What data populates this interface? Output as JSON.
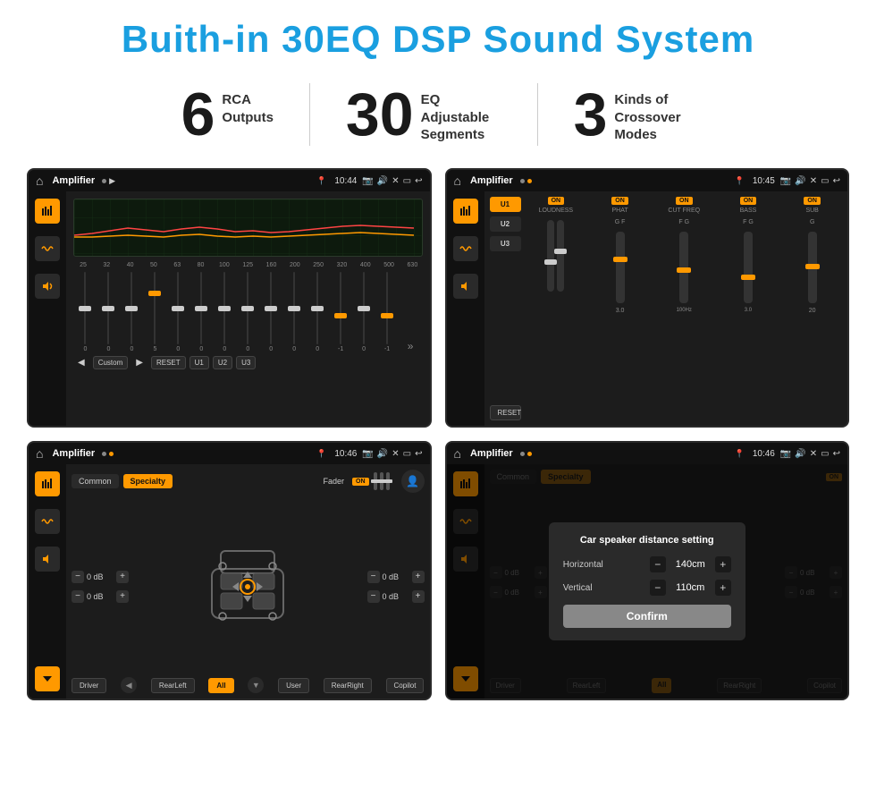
{
  "page": {
    "title": "Buith-in 30EQ DSP Sound System",
    "title_color": "#1a9fe0"
  },
  "stats": [
    {
      "id": "rca",
      "number": "6",
      "label": "RCA\nOutputs"
    },
    {
      "id": "eq",
      "number": "30",
      "label": "EQ Adjustable\nSegments"
    },
    {
      "id": "crossover",
      "number": "3",
      "label": "Kinds of\nCrossover Modes"
    }
  ],
  "screens": {
    "eq_screen": {
      "title": "Amplifier",
      "time": "10:44",
      "eq_values": [
        "25",
        "32",
        "40",
        "50",
        "63",
        "80",
        "100",
        "125",
        "160",
        "200",
        "250",
        "320",
        "400",
        "500",
        "630"
      ],
      "bottom_values": [
        "0",
        "0",
        "0",
        "5",
        "0",
        "0",
        "0",
        "0",
        "0",
        "0",
        "0",
        "-1",
        "0",
        "-1"
      ],
      "buttons": [
        "Custom",
        "RESET",
        "U1",
        "U2",
        "U3"
      ]
    },
    "amp_screen": {
      "title": "Amplifier",
      "time": "10:45",
      "presets": [
        "U1",
        "U2",
        "U3"
      ],
      "controls": [
        "LOUDNESS",
        "PHAT",
        "CUT FREQ",
        "BASS",
        "SUB"
      ],
      "reset_label": "RESET"
    },
    "cs_screen": {
      "title": "Amplifier",
      "time": "10:46",
      "tabs": [
        "Common",
        "Specialty"
      ],
      "fader_label": "Fader",
      "on_label": "ON",
      "left_dbs": [
        "0 dB",
        "0 dB"
      ],
      "right_dbs": [
        "0 dB",
        "0 dB"
      ],
      "bottom_buttons": [
        "Driver",
        "RearLeft",
        "All",
        "User",
        "RearRight",
        "Copilot"
      ]
    },
    "dialog_screen": {
      "title": "Amplifier",
      "time": "10:46",
      "tabs": [
        "Common",
        "Specialty"
      ],
      "dialog_title": "Car speaker distance setting",
      "horizontal_label": "Horizontal",
      "horizontal_value": "140cm",
      "vertical_label": "Vertical",
      "vertical_value": "110cm",
      "confirm_label": "Confirm",
      "left_db": "0 dB",
      "right_db": "0 dB",
      "bottom_buttons": [
        "Driver",
        "RearLeft",
        "All",
        "User",
        "RearRight",
        "Copilot"
      ]
    }
  },
  "icons": {
    "home": "⌂",
    "back": "↩",
    "equalizer": "≡",
    "wave": "〜",
    "speaker": "◁",
    "location": "📍",
    "camera": "📷",
    "volume": "🔊",
    "close": "✕",
    "minimize": "—",
    "settings": "⚙",
    "play": "▶",
    "prev": "◀",
    "next": "▶",
    "chevron_right": "»",
    "minus": "−",
    "plus": "+"
  }
}
